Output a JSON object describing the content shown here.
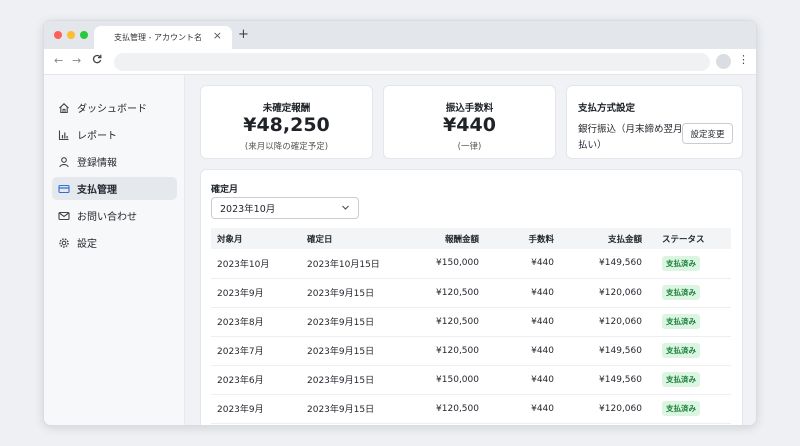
{
  "browser": {
    "tab_title": "支払管理 - アカウント名",
    "tab_close": "×",
    "new_tab": "+",
    "back": "←",
    "forward": "→",
    "reload": "C",
    "menu": "⋮"
  },
  "sidebar": {
    "items": [
      {
        "label": "ダッシュボード",
        "icon": "home-icon"
      },
      {
        "label": "レポート",
        "icon": "bar-chart-icon"
      },
      {
        "label": "登録情報",
        "icon": "user-icon"
      },
      {
        "label": "支払管理",
        "icon": "credit-card-icon",
        "active": true
      },
      {
        "label": "お問い合わせ",
        "icon": "mail-icon"
      },
      {
        "label": "設定",
        "icon": "gear-icon"
      }
    ]
  },
  "cards": {
    "unconfirmed": {
      "title": "未確定報酬",
      "value": "¥48,250",
      "sub": "(来月以降の確定予定)"
    },
    "fee": {
      "title": "振込手数料",
      "value": "¥440",
      "sub": "(一律)"
    },
    "payment_method": {
      "title": "支払方式設定",
      "desc": "銀行振込（月末締め翌月払い）",
      "button": "設定変更"
    }
  },
  "filter": {
    "label": "確定月",
    "selected": "2023年10月"
  },
  "table": {
    "headers": [
      "対象月",
      "確定日",
      "報酬金額",
      "手数料",
      "支払金額",
      "ステータス"
    ],
    "rows": [
      [
        "2023年10月",
        "2023年10月15日",
        "¥150,000",
        "¥440",
        "¥149,560",
        "支払済み"
      ],
      [
        "2023年9月",
        "2023年9月15日",
        "¥120,500",
        "¥440",
        "¥120,060",
        "支払済み"
      ],
      [
        "2023年8月",
        "2023年9月15日",
        "¥120,500",
        "¥440",
        "¥120,060",
        "支払済み"
      ],
      [
        "2023年7月",
        "2023年9月15日",
        "¥120,500",
        "¥440",
        "¥149,560",
        "支払済み"
      ],
      [
        "2023年6月",
        "2023年9月15日",
        "¥150,000",
        "¥440",
        "¥149,560",
        "支払済み"
      ],
      [
        "2023年9月",
        "2023年9月15日",
        "¥120,500",
        "¥440",
        "¥120,060",
        "支払済み"
      ]
    ]
  },
  "colors": {
    "status_bg": "#dcf5e3",
    "status_text": "#1a7f37",
    "active_nav": "#e5e8ed"
  }
}
